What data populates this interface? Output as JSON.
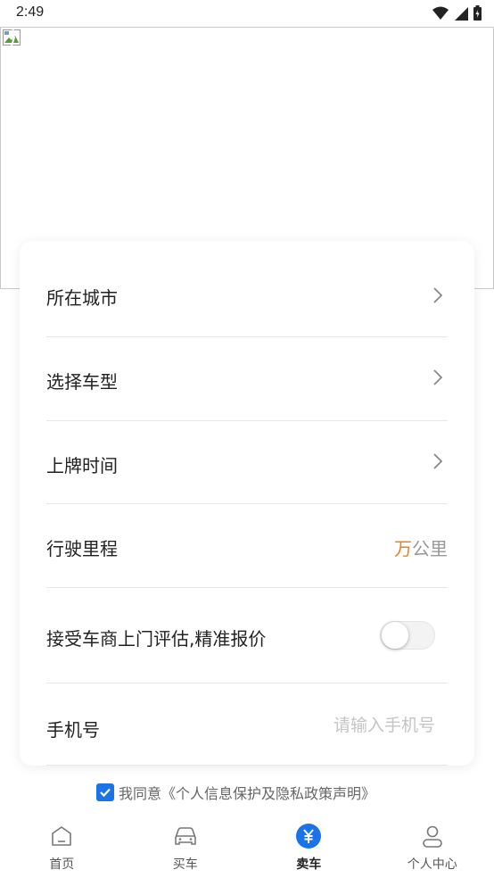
{
  "status_bar": {
    "time": "2:49"
  },
  "form": {
    "city": {
      "label": "所在城市"
    },
    "model": {
      "label": "选择车型"
    },
    "reg_time": {
      "label": "上牌时间"
    },
    "mileage": {
      "label": "行驶里程",
      "unit_accent": "万",
      "unit": "公里"
    },
    "dealer_visit": {
      "label": "接受车商上门评估,精准报价",
      "enabled": false
    },
    "phone": {
      "label": "手机号",
      "placeholder": "请输入手机号",
      "value": ""
    }
  },
  "agreement": {
    "checked": true,
    "text": "我同意《个人信息保护及隐私政策声明》"
  },
  "tabs": [
    {
      "label": "首页",
      "icon": "home-icon",
      "active": false
    },
    {
      "label": "买车",
      "icon": "car-icon",
      "active": false
    },
    {
      "label": "卖车",
      "icon": "yuan-icon",
      "active": true
    },
    {
      "label": "个人中心",
      "icon": "user-icon",
      "active": false
    }
  ],
  "colors": {
    "accent": "#1a73e8",
    "orange": "#f07f1e"
  }
}
